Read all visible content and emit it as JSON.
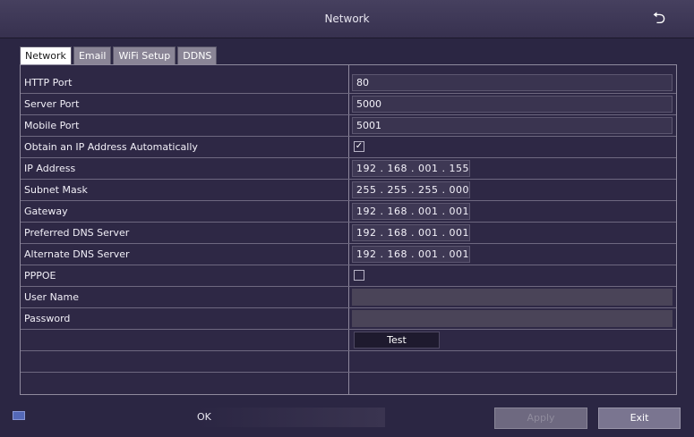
{
  "window": {
    "title": "Network",
    "back_icon": "return-arrow-icon"
  },
  "tabs": [
    {
      "label": "Network",
      "active": true
    },
    {
      "label": "Email",
      "active": false
    },
    {
      "label": "WiFi Setup",
      "active": false
    },
    {
      "label": "DDNS",
      "active": false
    }
  ],
  "form": {
    "http_port": {
      "label": "HTTP Port",
      "value": "80"
    },
    "server_port": {
      "label": "Server Port",
      "value": "5000"
    },
    "mobile_port": {
      "label": "Mobile Port",
      "value": "5001"
    },
    "obtain_ip_auto": {
      "label": "Obtain an IP Address Automatically",
      "checked": true,
      "mark": "✓"
    },
    "ip_address": {
      "label": "IP Address",
      "value": "192 . 168 . 001 . 155"
    },
    "subnet_mask": {
      "label": "Subnet Mask",
      "value": "255 . 255 . 255 . 000"
    },
    "gateway": {
      "label": "Gateway",
      "value": "192 . 168 . 001 . 001"
    },
    "preferred_dns": {
      "label": "Preferred DNS Server",
      "value": "192 . 168 . 001 . 001"
    },
    "alternate_dns": {
      "label": "Alternate DNS Server",
      "value": "192 . 168 . 001 . 001"
    },
    "pppoe": {
      "label": "PPPOE",
      "checked": false
    },
    "user_name": {
      "label": "User Name",
      "value": ""
    },
    "password": {
      "label": "Password",
      "value": ""
    },
    "test_button": "Test"
  },
  "footer": {
    "status": "OK",
    "apply_label": "Apply",
    "exit_label": "Exit"
  }
}
